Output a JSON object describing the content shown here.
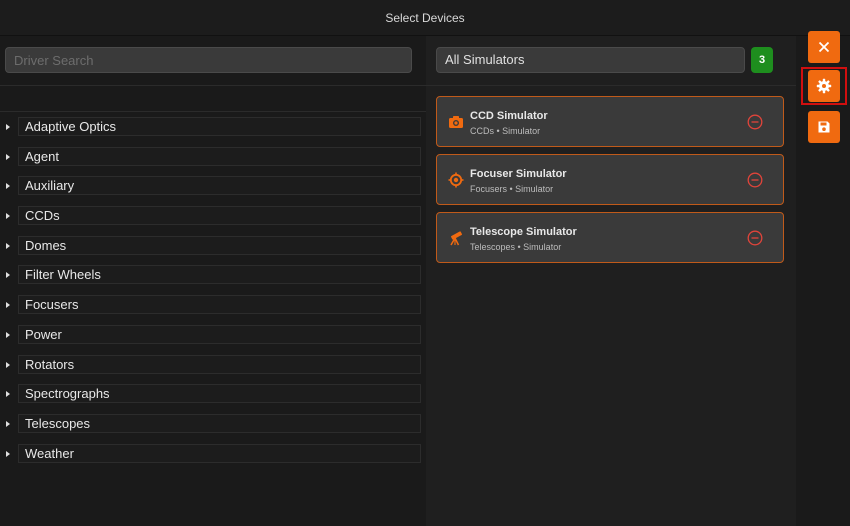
{
  "window": {
    "title": "Select Devices"
  },
  "search": {
    "placeholder": "Driver Search",
    "value": ""
  },
  "groups": [
    {
      "label": "Adaptive Optics"
    },
    {
      "label": "Agent"
    },
    {
      "label": "Auxiliary"
    },
    {
      "label": "CCDs"
    },
    {
      "label": "Domes"
    },
    {
      "label": "Filter Wheels"
    },
    {
      "label": "Focusers"
    },
    {
      "label": "Power"
    },
    {
      "label": "Rotators"
    },
    {
      "label": "Spectrographs"
    },
    {
      "label": "Telescopes"
    },
    {
      "label": "Weather"
    }
  ],
  "profile": {
    "selected": "All Simulators",
    "count": "3"
  },
  "devices": [
    {
      "name": "CCD Simulator",
      "subtitle": "CCDs • Simulator",
      "icon": "camera-icon"
    },
    {
      "name": "Focuser Simulator",
      "subtitle": "Focusers • Simulator",
      "icon": "focuser-icon"
    },
    {
      "name": "Telescope Simulator",
      "subtitle": "Telescopes • Simulator",
      "icon": "telescope-icon"
    }
  ],
  "actions": {
    "close": {
      "icon": "close-icon"
    },
    "settings": {
      "icon": "gear-icon"
    },
    "save": {
      "icon": "save-icon"
    }
  },
  "colors": {
    "accent": "#f06a10",
    "badge": "#1e8e1e",
    "card_border": "#c05a1a",
    "highlight": "#d10f0f"
  }
}
